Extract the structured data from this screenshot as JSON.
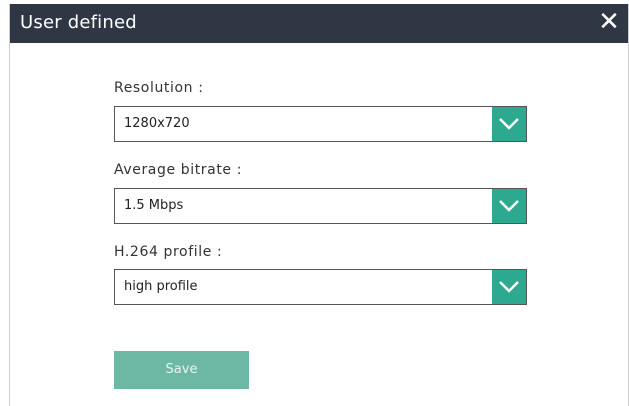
{
  "dialog": {
    "title": "User defined",
    "close_icon": "close-icon",
    "fields": [
      {
        "label": "Resolution :",
        "value": "1280x720"
      },
      {
        "label": "Average bitrate :",
        "value": "1.5 Mbps"
      },
      {
        "label": "H.264 profile :",
        "value": "high profile"
      }
    ],
    "save_label": "Save"
  },
  "colors": {
    "titlebar": "#2f3745",
    "accent": "#2ca98f",
    "save_button": "#6db8a5"
  }
}
